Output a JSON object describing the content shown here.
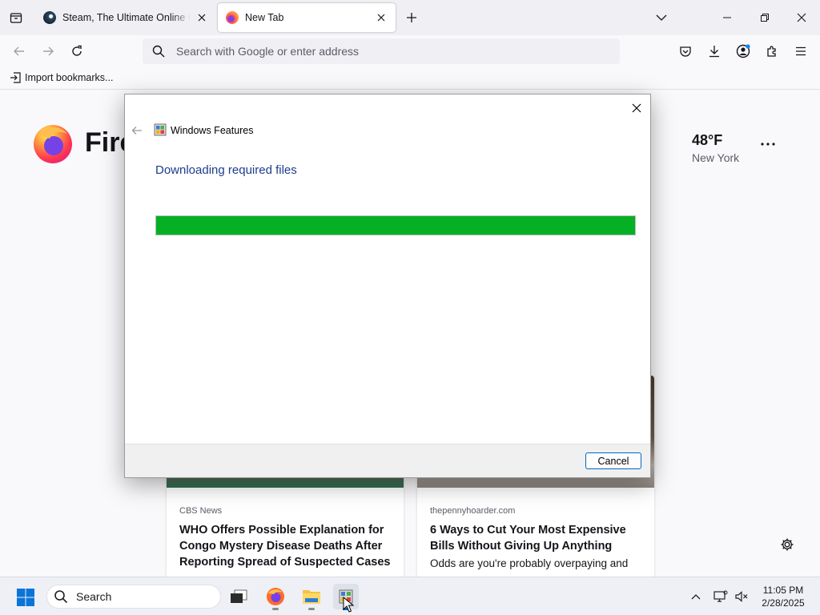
{
  "browser": {
    "tabs": [
      {
        "title": "Steam, The Ultimate Online Game Platform",
        "icon": "steam-icon",
        "active": false
      },
      {
        "title": "New Tab",
        "icon": "firefox-icon",
        "active": true
      }
    ],
    "urlbar": {
      "placeholder": "Search with Google or enter address",
      "value": ""
    },
    "bookmarks": [
      {
        "label": "Import bookmarks..."
      }
    ]
  },
  "newtab": {
    "brand": "Fire",
    "weather": {
      "temp": "48°F",
      "location": "New York"
    },
    "stories": [
      {
        "source": "CBS News",
        "headline": "WHO Offers Possible Explanation for Congo Mystery Disease Deaths After Reporting Spread of Suspected Cases",
        "excerpt": ""
      },
      {
        "source": "thepennyhoarder.com",
        "headline": "6 Ways to Cut Your Most Expensive Bills Without Giving Up Anything",
        "excerpt": "Odds are you're probably overpaying and"
      }
    ]
  },
  "dialog": {
    "title": "Windows Features",
    "heading": "Downloading required files",
    "progress": 1.0,
    "progress_color": "#06b025",
    "cancel_label": "Cancel"
  },
  "taskbar": {
    "search_label": "Search",
    "apps": [
      "task-view-icon",
      "firefox-icon",
      "file-explorer-icon",
      "windows-features-icon"
    ],
    "clock": {
      "time": "11:05 PM",
      "date": "2/28/2025"
    }
  }
}
